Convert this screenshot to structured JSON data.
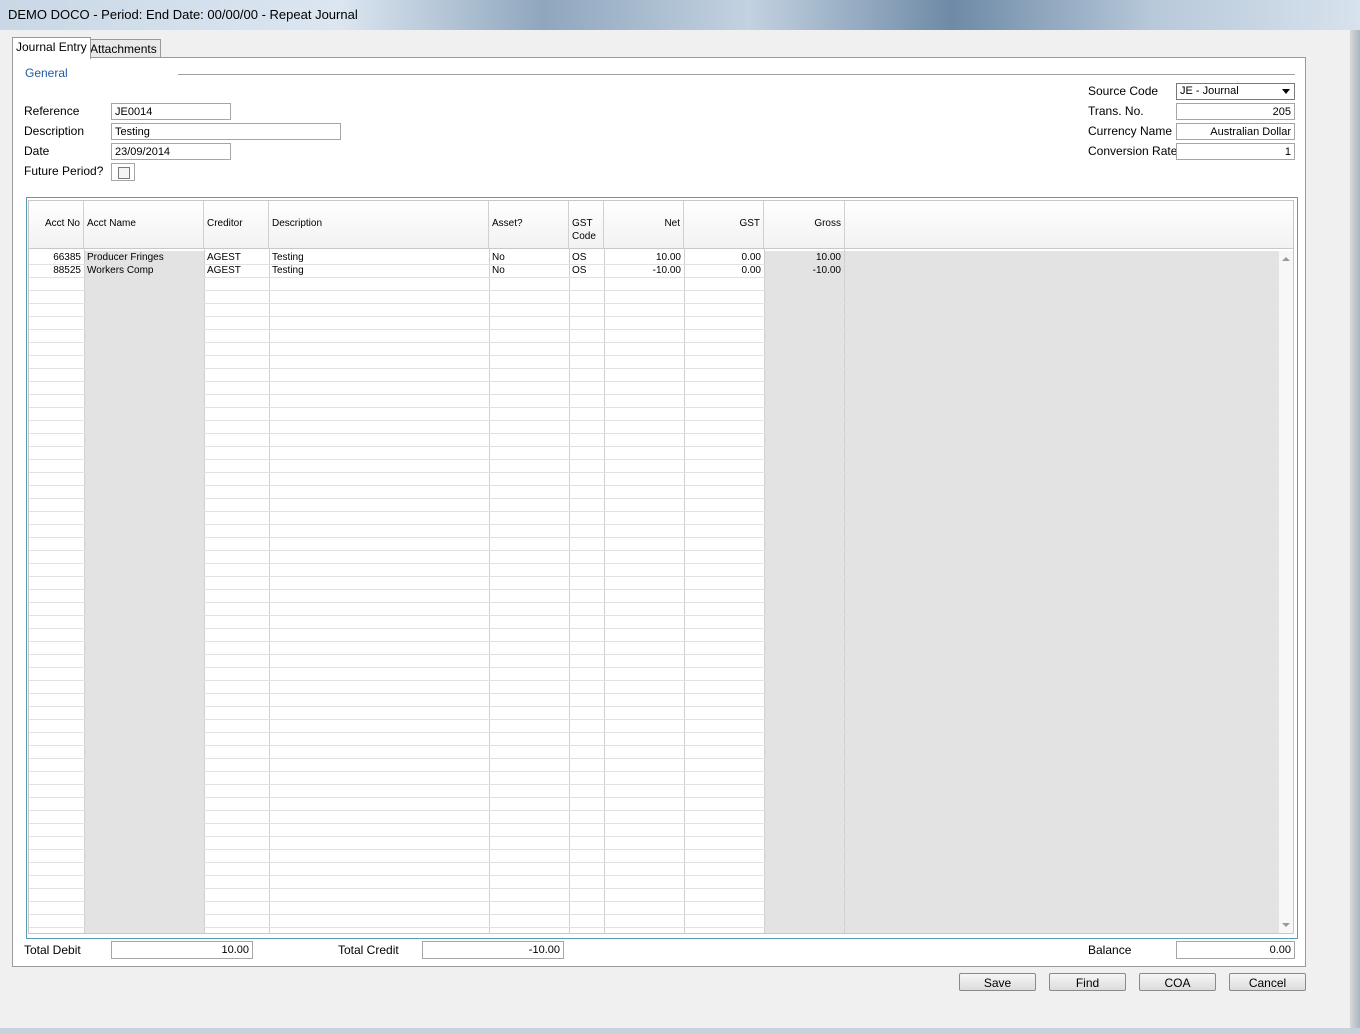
{
  "window": {
    "title": "DEMO DOCO  - Period:  End Date: 00/00/00 - Repeat Journal"
  },
  "tabs": [
    {
      "label": "Journal Entry",
      "active": true
    },
    {
      "label": "Attachments",
      "active": false
    }
  ],
  "general": {
    "group_label": "General",
    "reference_label": "Reference",
    "reference_value": "JE0014",
    "description_label": "Description",
    "description_value": "Testing",
    "date_label": "Date",
    "date_value": "23/09/2014",
    "future_period_label": "Future Period?",
    "future_period_checked": false
  },
  "header_right": {
    "source_code_label": "Source Code",
    "source_code_value": "JE - Journal",
    "trans_no_label": "Trans. No.",
    "trans_no_value": "205",
    "currency_name_label": "Currency Name",
    "currency_name_value": "Australian Dollar",
    "conversion_rate_label": "Conversion Rate",
    "conversion_rate_value": "1"
  },
  "grid": {
    "columns": [
      {
        "key": "acct_no",
        "label": "Acct No"
      },
      {
        "key": "acct_name",
        "label": "Acct Name"
      },
      {
        "key": "creditor",
        "label": "Creditor"
      },
      {
        "key": "description",
        "label": "Description"
      },
      {
        "key": "asset",
        "label": "Asset?"
      },
      {
        "key": "gst_code",
        "label": "GST\nCode"
      },
      {
        "key": "net",
        "label": "Net"
      },
      {
        "key": "gst",
        "label": "GST"
      },
      {
        "key": "gross",
        "label": "Gross"
      }
    ],
    "rows": [
      {
        "acct_no": "66385",
        "acct_name": "Producer Fringes",
        "creditor": "AGEST",
        "description": "Testing",
        "asset": "No",
        "gst_code": "OS",
        "net": "10.00",
        "gst": "0.00",
        "gross": "10.00"
      },
      {
        "acct_no": "88525",
        "acct_name": "Workers Comp",
        "creditor": "AGEST",
        "description": "Testing",
        "asset": "No",
        "gst_code": "OS",
        "net": "-10.00",
        "gst": "0.00",
        "gross": "-10.00"
      }
    ]
  },
  "totals": {
    "total_debit_label": "Total Debit",
    "total_debit_value": "10.00",
    "total_credit_label": "Total Credit",
    "total_credit_value": "-10.00",
    "balance_label": "Balance",
    "balance_value": "0.00"
  },
  "buttons": {
    "save": "Save",
    "find": "Find",
    "coa": "COA",
    "cancel": "Cancel"
  },
  "colors": {
    "group_label": "#1f5aa8",
    "grid_border": "#5b9bb5",
    "readonly_column_bg": "#e3e3e3"
  }
}
